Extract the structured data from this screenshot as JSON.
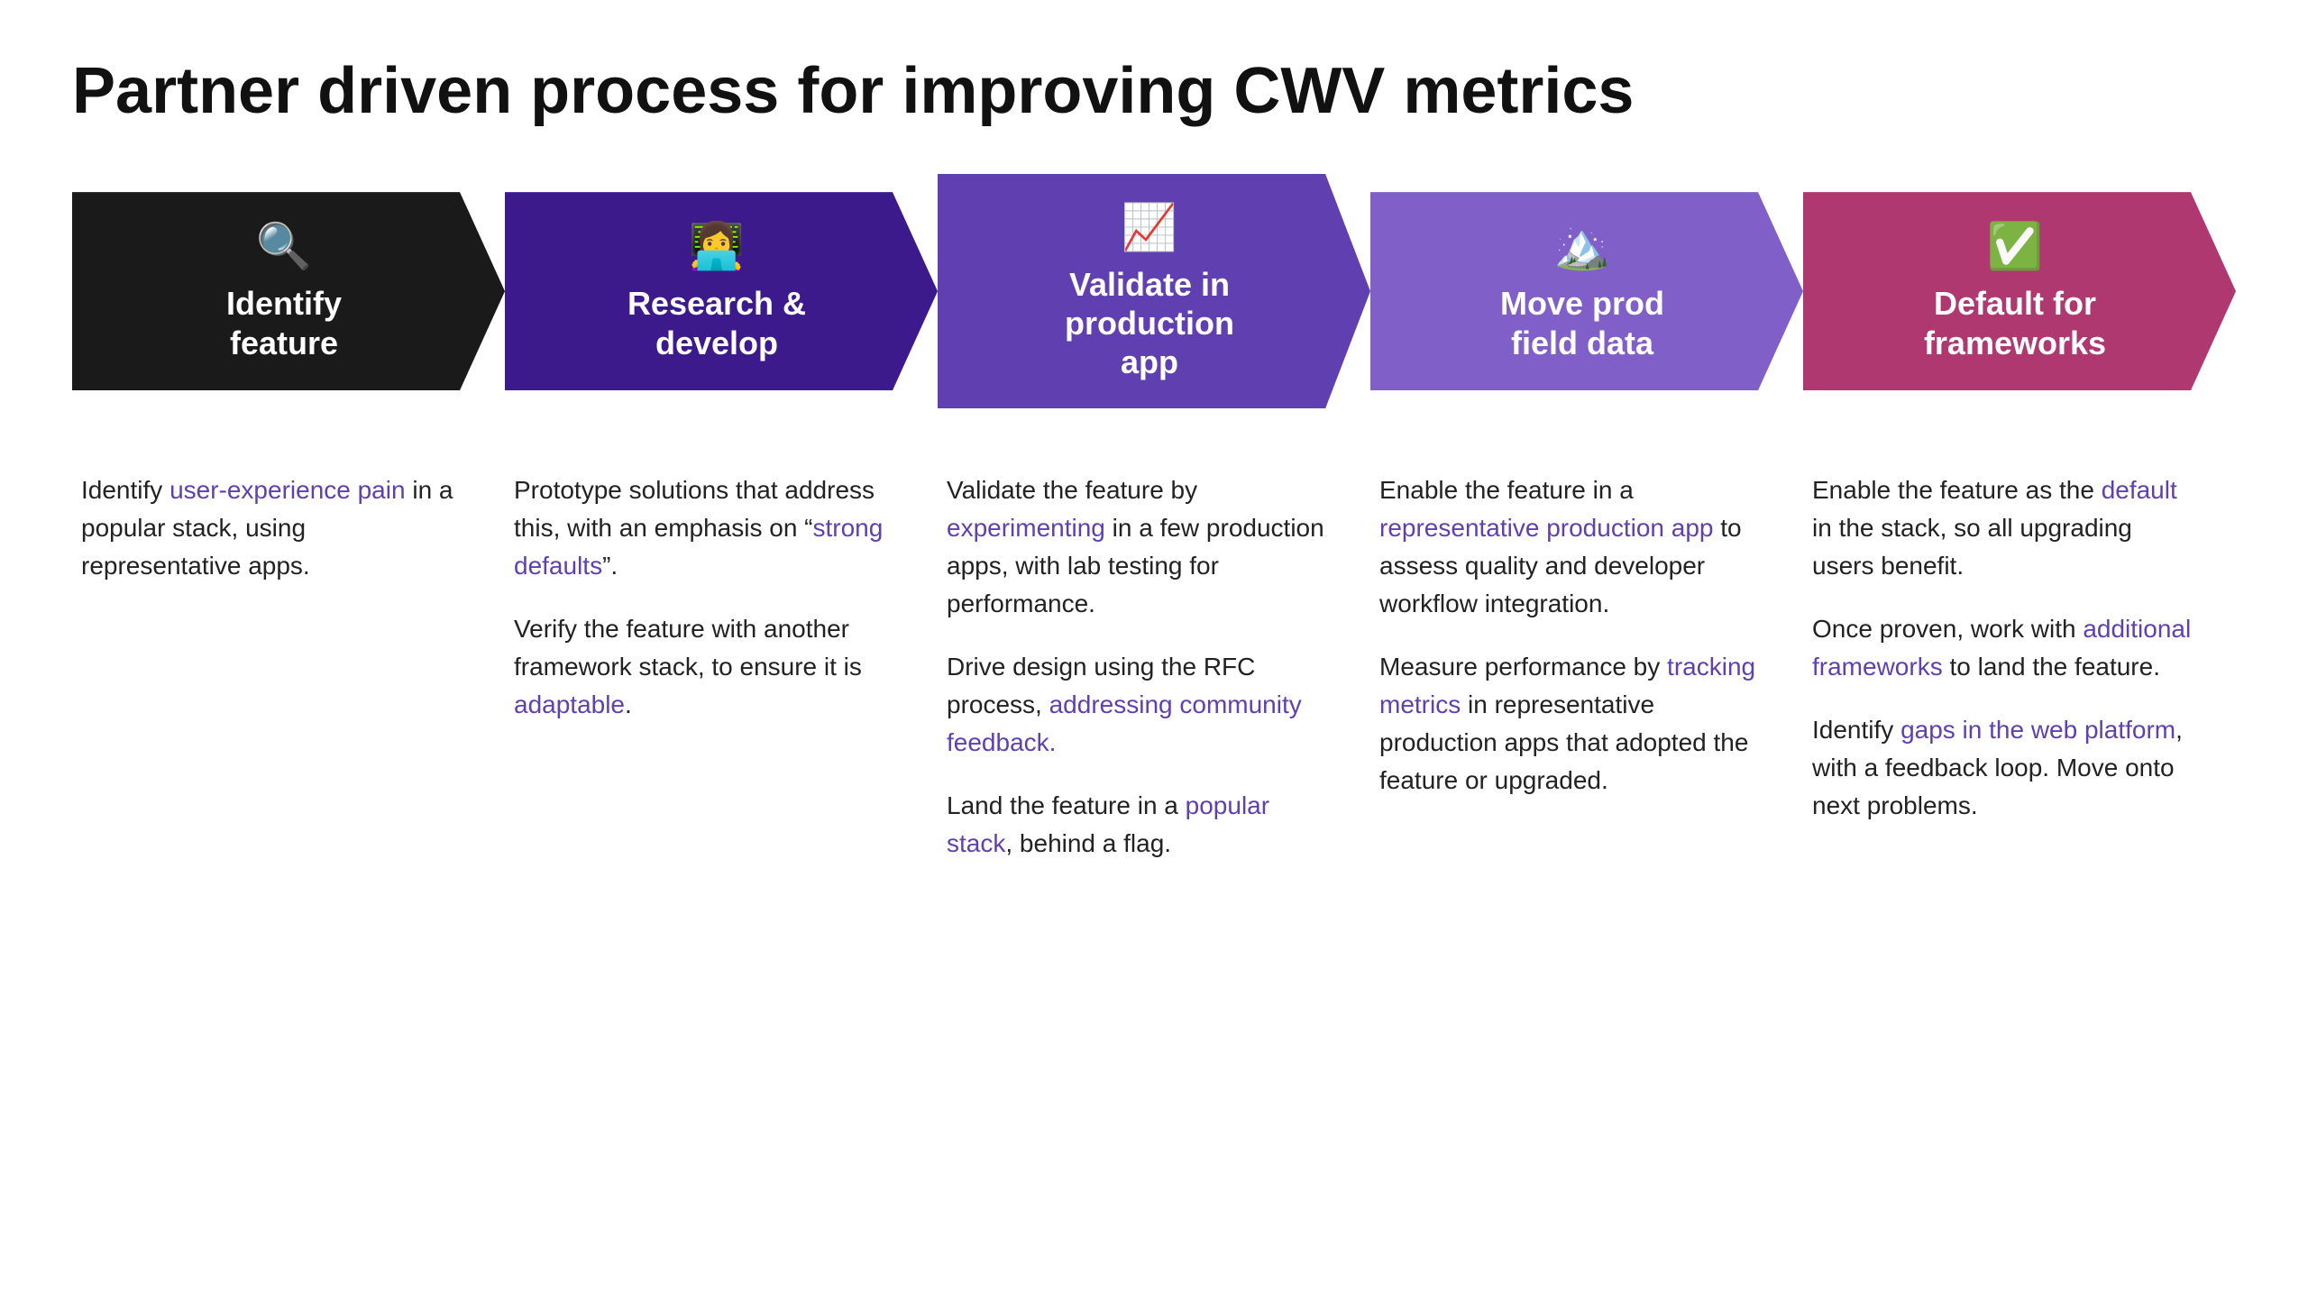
{
  "page": {
    "title": "Partner driven process for improving CWV metrics"
  },
  "chevrons": [
    {
      "id": "identify",
      "icon": "🔍",
      "title": "Identify\nfeature",
      "colorClass": "chevron-black",
      "isFirst": true
    },
    {
      "id": "research",
      "icon": "👩‍💻",
      "title": "Research &\ndevelop",
      "colorClass": "chevron-dark-purple",
      "isFirst": false
    },
    {
      "id": "validate",
      "icon": "📈",
      "title": "Validate in\nproduction\napp",
      "colorClass": "chevron-medium-purple",
      "isFirst": false
    },
    {
      "id": "move",
      "icon": "🏔️",
      "title": "Move prod\nfield data",
      "colorClass": "chevron-light-purple",
      "isFirst": false
    },
    {
      "id": "default",
      "icon": "✅",
      "title": "Default for\nframeworks",
      "colorClass": "chevron-rose",
      "isFirst": false
    }
  ],
  "columns": [
    {
      "id": "identify-content",
      "paragraphs": [
        {
          "parts": [
            {
              "text": "Identify ",
              "type": "normal"
            },
            {
              "text": "user-experience pain",
              "type": "link-purple"
            },
            {
              "text": " in a popular stack, using representative apps.",
              "type": "normal"
            }
          ]
        }
      ]
    },
    {
      "id": "research-content",
      "paragraphs": [
        {
          "parts": [
            {
              "text": "Prototype solutions that address this, with an emphasis on “",
              "type": "normal"
            },
            {
              "text": "strong defaults",
              "type": "link-purple"
            },
            {
              "text": "”.",
              "type": "normal"
            }
          ]
        },
        {
          "parts": [
            {
              "text": "Verify the feature with another framework stack, to ensure it is ",
              "type": "normal"
            },
            {
              "text": "adaptable",
              "type": "link-purple"
            },
            {
              "text": ".",
              "type": "normal"
            }
          ]
        }
      ]
    },
    {
      "id": "validate-content",
      "paragraphs": [
        {
          "parts": [
            {
              "text": "Validate the feature by ",
              "type": "normal"
            },
            {
              "text": "experimenting",
              "type": "link-purple"
            },
            {
              "text": " in a few production apps, with lab testing for performance.",
              "type": "normal"
            }
          ]
        },
        {
          "parts": [
            {
              "text": "Drive design using the RFC process, ",
              "type": "normal"
            },
            {
              "text": "addressing community feedback.",
              "type": "link-purple"
            }
          ]
        },
        {
          "parts": [
            {
              "text": "Land the feature in a ",
              "type": "normal"
            },
            {
              "text": "popular stack",
              "type": "link-purple"
            },
            {
              "text": ", behind a flag.",
              "type": "normal"
            }
          ]
        }
      ]
    },
    {
      "id": "move-content",
      "paragraphs": [
        {
          "parts": [
            {
              "text": "Enable the feature in a ",
              "type": "normal"
            },
            {
              "text": "representative production app",
              "type": "link-purple"
            },
            {
              "text": " to assess quality and developer workflow integration.",
              "type": "normal"
            }
          ]
        },
        {
          "parts": [
            {
              "text": "Measure performance by ",
              "type": "normal"
            },
            {
              "text": "tracking metrics",
              "type": "link-purple"
            },
            {
              "text": " in representative production apps that adopted the feature or upgraded.",
              "type": "normal"
            }
          ]
        }
      ]
    },
    {
      "id": "default-content",
      "paragraphs": [
        {
          "parts": [
            {
              "text": "Enable the feature as the ",
              "type": "normal"
            },
            {
              "text": "default",
              "type": "link-purple"
            },
            {
              "text": " in the stack, so all upgrading users benefit.",
              "type": "normal"
            }
          ]
        },
        {
          "parts": [
            {
              "text": "Once proven, work with ",
              "type": "normal"
            },
            {
              "text": "additional frameworks",
              "type": "link-purple"
            },
            {
              "text": " to land the feature.",
              "type": "normal"
            }
          ]
        },
        {
          "parts": [
            {
              "text": "Identify ",
              "type": "normal"
            },
            {
              "text": "gaps in the web platform",
              "type": "link-purple"
            },
            {
              "text": ", with a feedback loop. Move onto next problems.",
              "type": "normal"
            }
          ]
        }
      ]
    }
  ]
}
